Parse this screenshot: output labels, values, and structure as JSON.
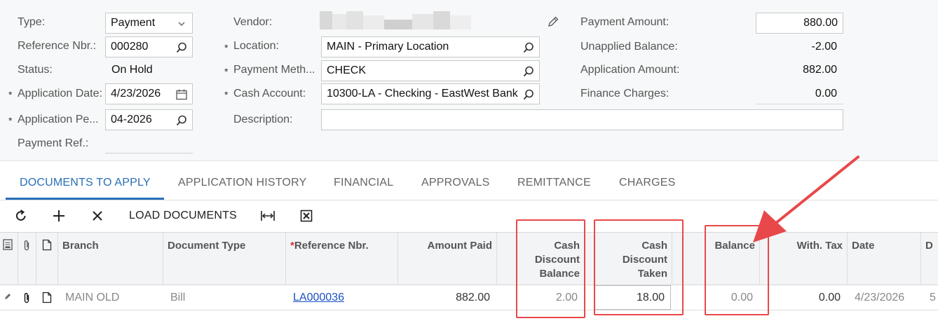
{
  "form": {
    "type_label": "Type:",
    "type_value": "Payment",
    "ref_label": "Reference Nbr.:",
    "ref_value": "000280",
    "status_label": "Status:",
    "status_value": "On Hold",
    "appdate_label": "Application Date:",
    "appdate_value": "4/23/2026",
    "appperiod_label": "Application Pe...",
    "appperiod_value": "04-2026",
    "payref_label": "Payment Ref.:",
    "vendor_label": "Vendor:",
    "location_label": "Location:",
    "location_value": "MAIN - Primary Location",
    "paymethod_label": "Payment Meth...",
    "paymethod_value": "CHECK",
    "cashacct_label": "Cash Account:",
    "cashacct_value": "10300-LA - Checking - EastWest Bank",
    "desc_label": "Description:",
    "payamt_label": "Payment Amount:",
    "payamt_value": "880.00",
    "unapplied_label": "Unapplied Balance:",
    "unapplied_value": "-2.00",
    "appamt_label": "Application Amount:",
    "appamt_value": "882.00",
    "finchg_label": "Finance Charges:",
    "finchg_value": "0.00",
    "required_mark": "*"
  },
  "tabs": [
    "DOCUMENTS TO APPLY",
    "APPLICATION HISTORY",
    "FINANCIAL",
    "APPROVALS",
    "REMITTANCE",
    "CHARGES"
  ],
  "toolbar": {
    "load_label": "LOAD DOCUMENTS"
  },
  "grid": {
    "headers": {
      "branch": "Branch",
      "doctype": "Document Type",
      "refnbr": "Reference Nbr.",
      "amtpaid": "Amount Paid",
      "cdbal_1": "Cash",
      "cdbal_2": "Discount",
      "cdbal_3": "Balance",
      "cdtaken_1": "Cash",
      "cdtaken_2": "Discount",
      "cdtaken_3": "Taken",
      "balance": "Balance",
      "withtax": "With. Tax",
      "date": "Date",
      "next": "D"
    },
    "rows": [
      {
        "branch": "MAIN OLD",
        "doctype": "Bill",
        "refnbr": "LA000036",
        "amtpaid": "882.00",
        "cdbal": "2.00",
        "cdtaken": "18.00",
        "balance": "0.00",
        "withtax": "0.00",
        "date": "4/23/2026",
        "next": "5"
      }
    ]
  },
  "colors": {
    "accent": "#2a6fb7",
    "annotation": "#e8484a",
    "link": "#1a4fc4"
  }
}
